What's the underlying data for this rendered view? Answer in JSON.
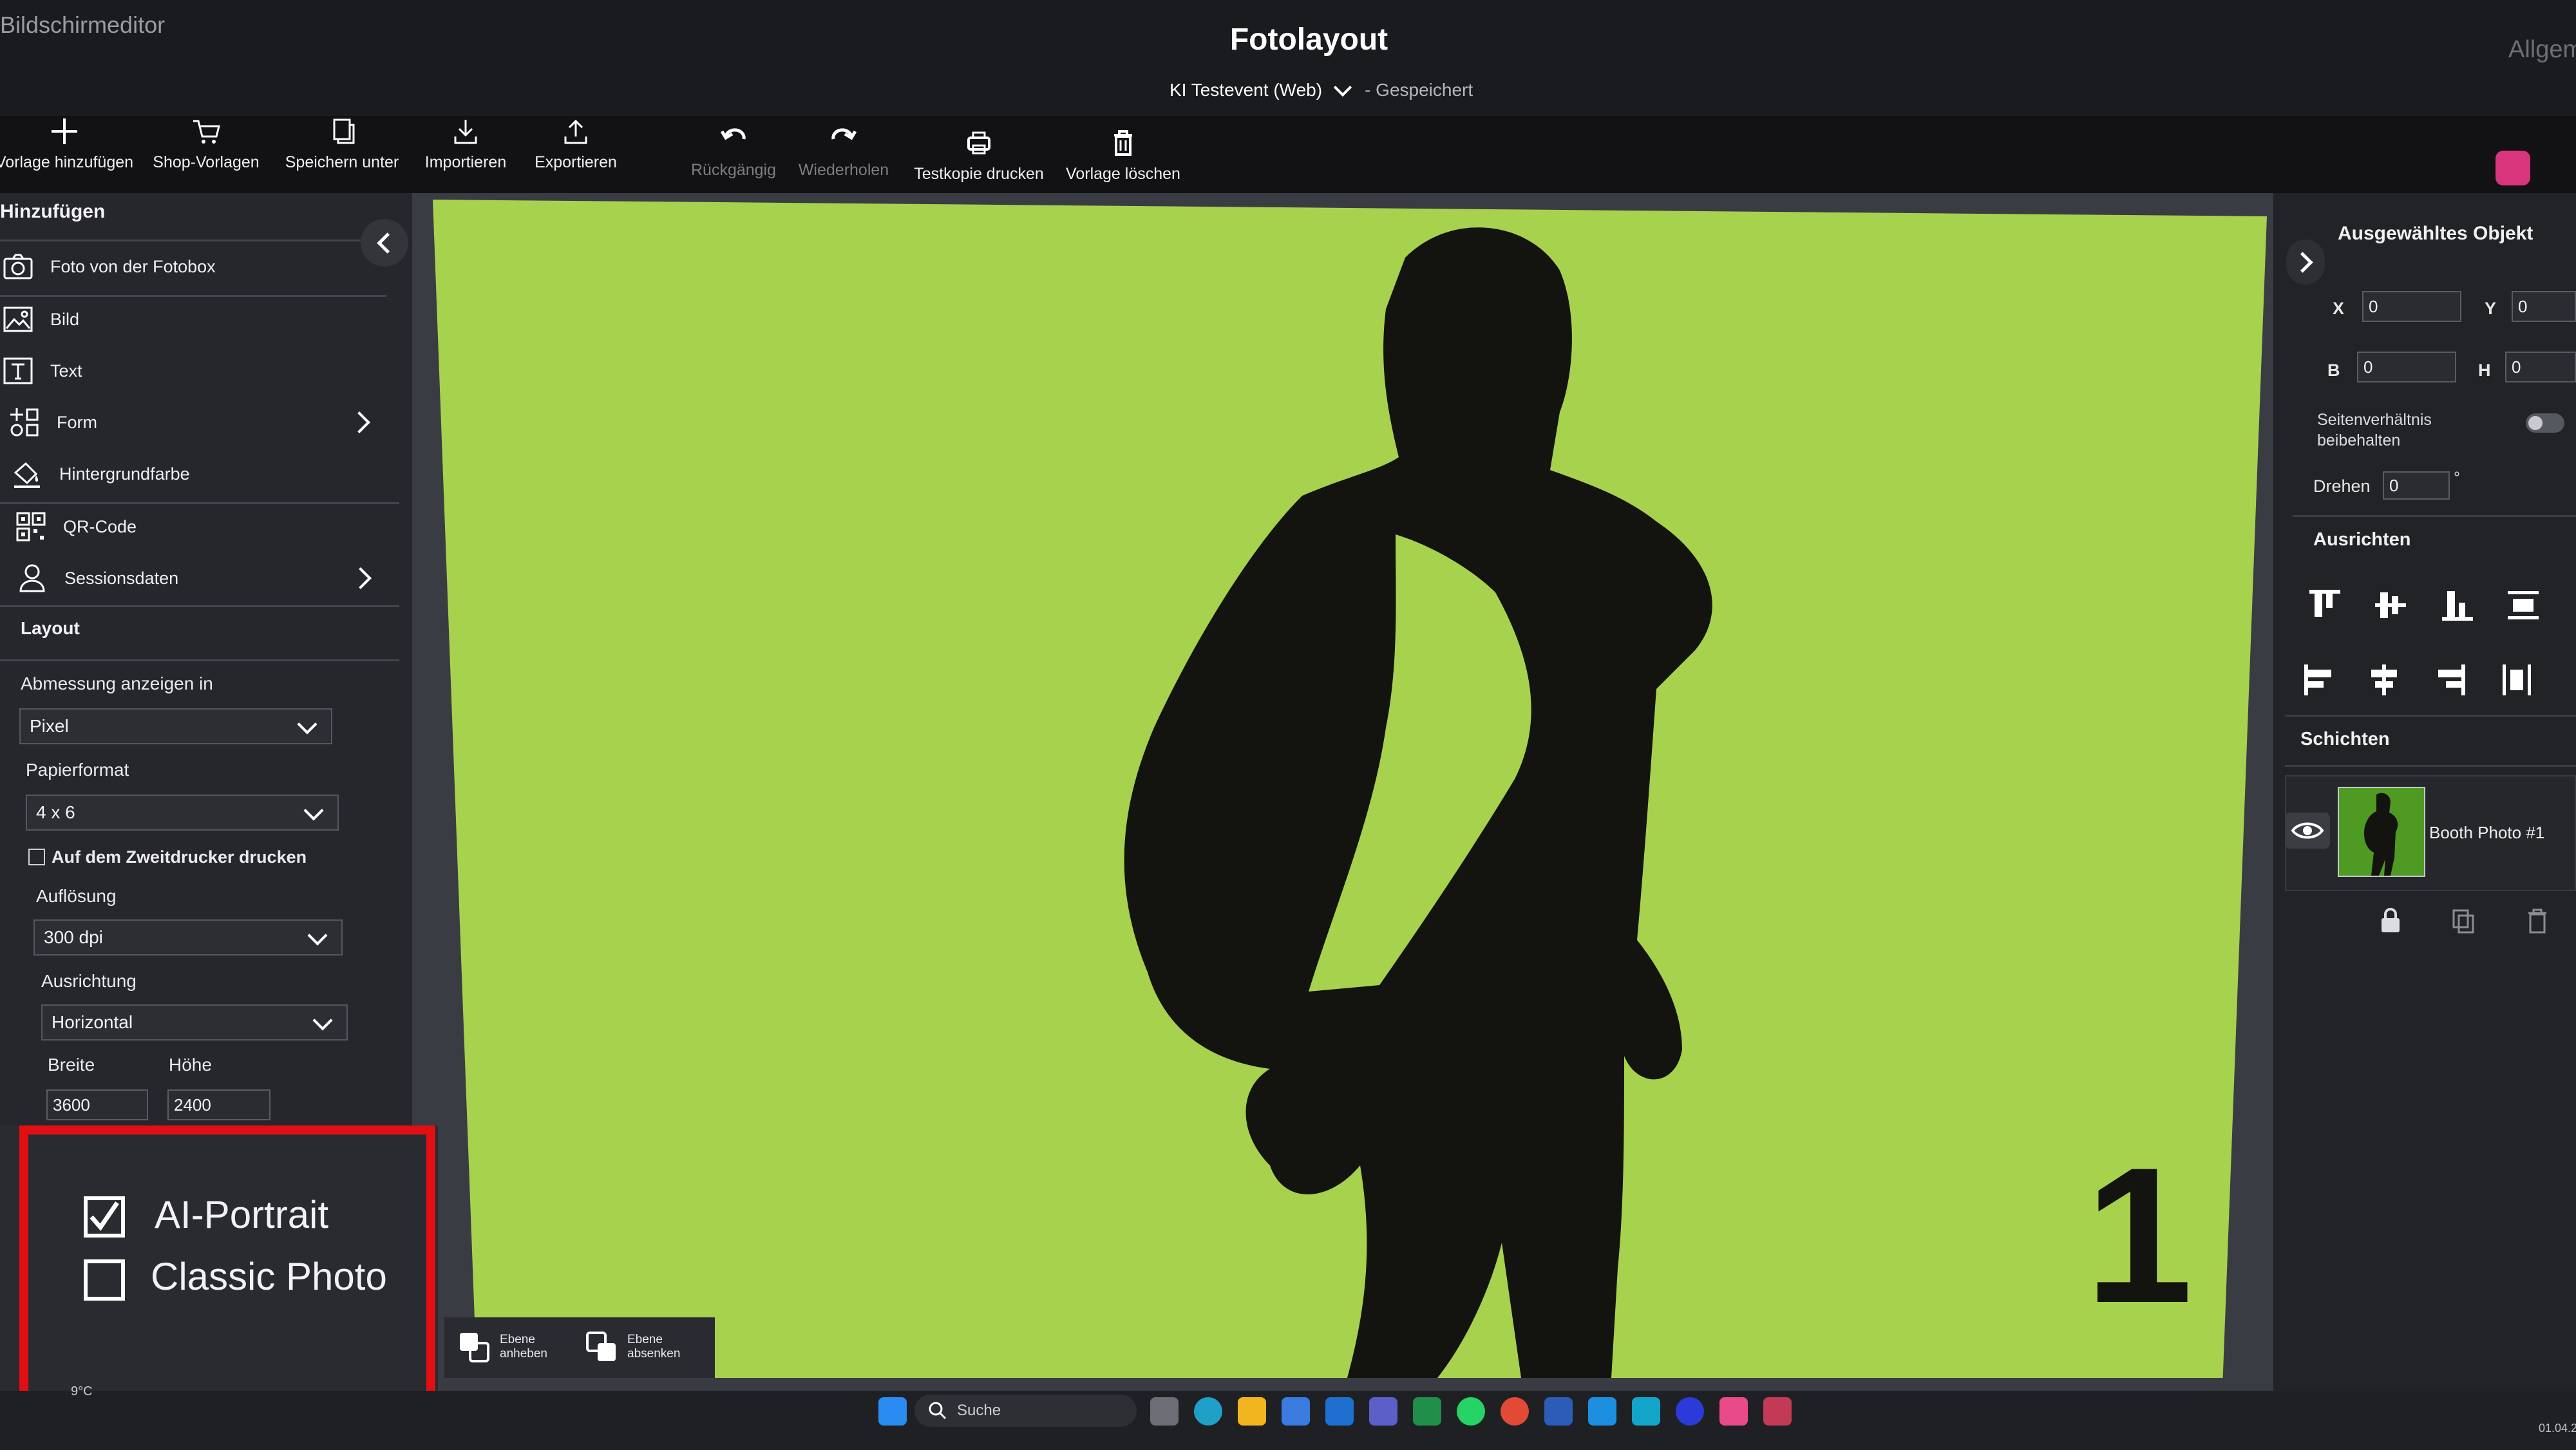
{
  "app": {
    "name": "Bildschirmeditor",
    "title": "Fotolayout",
    "event": "KI Testevent (Web)",
    "saved_status": "- Gespeichert",
    "top_right_cut": "Allgem"
  },
  "toolbar": {
    "add_template": "Vorlage hinzufügen",
    "shop_templates": "Shop-Vorlagen",
    "save_as": "Speichern unter",
    "import": "Importieren",
    "export": "Exportieren",
    "undo": "Rückgängig",
    "redo": "Wiederholen",
    "test_print": "Testkopie drucken",
    "delete_template": "Vorlage löschen"
  },
  "sidebar": {
    "add_header": "Hinzufügen",
    "items": [
      {
        "label": "Foto von der Fotobox",
        "icon": "camera-icon"
      },
      {
        "label": "Bild",
        "icon": "image-icon"
      },
      {
        "label": "Text",
        "icon": "text-icon"
      },
      {
        "label": "Form",
        "icon": "shapes-icon"
      },
      {
        "label": "Hintergrundfarbe",
        "icon": "paint-bucket-icon"
      },
      {
        "label": "QR-Code",
        "icon": "qr-code-icon"
      },
      {
        "label": "Sessionsdaten",
        "icon": "user-icon"
      }
    ],
    "layout_header": "Layout",
    "measure_label": "Abmessung anzeigen in",
    "measure_value": "Pixel",
    "paper_label": "Papierformat",
    "paper_value": "4 x 6",
    "second_printer": "Auf dem Zweitdrucker drucken",
    "resolution_label": "Auflösung",
    "resolution_value": "300 dpi",
    "orientation_label": "Ausrichtung",
    "orientation_value": "Horizontal",
    "width_label": "Breite",
    "height_label": "Höhe",
    "width_value": "3600",
    "height_value": "2400"
  },
  "overlay": {
    "ai_portrait": "AI-Portrait",
    "classic_photo": "Classic Photo",
    "ai_portrait_checked": true,
    "classic_photo_checked": false
  },
  "canvas": {
    "page_number": "1",
    "raise_layer": "Ebene anheben",
    "lower_layer": "Ebene absenken"
  },
  "right_panel": {
    "selected_header": "Ausgewähltes Objekt",
    "x_label": "X",
    "x_value": "0",
    "y_label": "Y",
    "y_value": "0",
    "b_label": "B",
    "b_value": "0",
    "h_label": "H",
    "h_value": "0",
    "aspect_label": "Seitenverhältnis beibehalten",
    "rotate_label": "Drehen",
    "rotate_value": "0",
    "rotate_unit": "°",
    "align_header": "Ausrichten",
    "layers_header": "Schichten",
    "layer_name": "Booth Photo #1"
  },
  "taskbar": {
    "search": "Suche",
    "weather": "9°C",
    "date": "01.04.2"
  },
  "colors": {
    "canvas_green": "#a7d24e",
    "highlight_red": "#e10f12",
    "silhouette": "#13140f"
  }
}
